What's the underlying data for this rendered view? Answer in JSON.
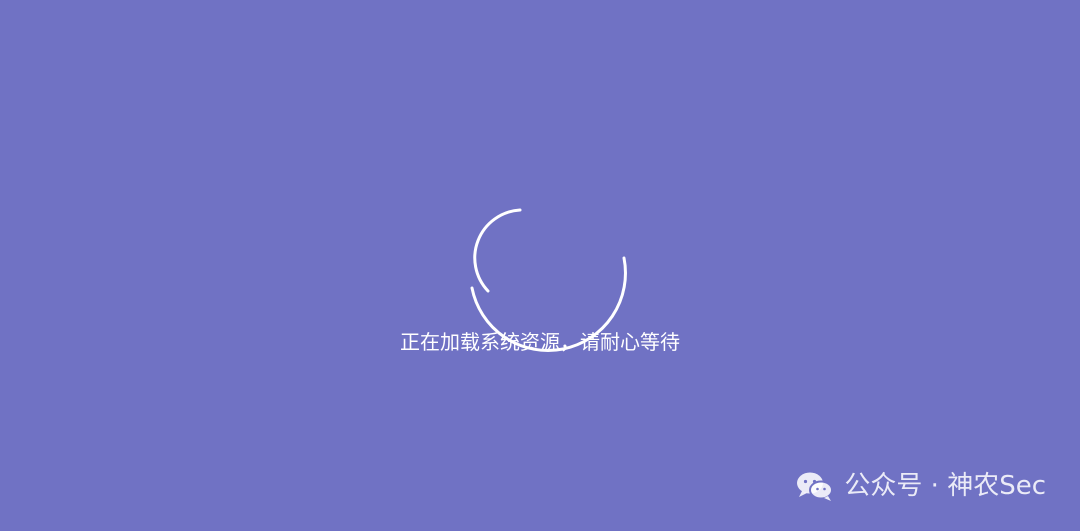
{
  "colors": {
    "background": "#7072c4",
    "spinner": "#ffffff",
    "text": "#ffffff",
    "watermark": "rgba(255,255,255,0.86)"
  },
  "loading": {
    "message": "正在加载系统资源，请耐心等待"
  },
  "watermark": {
    "icon": "wechat-icon",
    "text": "公众号 · 神农Sec"
  }
}
